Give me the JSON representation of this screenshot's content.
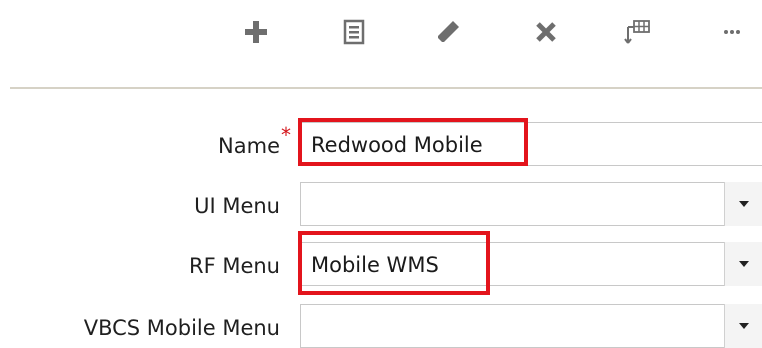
{
  "toolbar": {
    "actions": [
      {
        "icon": "add-icon"
      },
      {
        "icon": "details-icon"
      },
      {
        "icon": "edit-icon"
      },
      {
        "icon": "delete-icon"
      },
      {
        "icon": "grid-icon"
      },
      {
        "icon": "more-icon"
      }
    ],
    "icon_color": "#6e6e6e"
  },
  "form": {
    "name_label": "Name",
    "required_mark": "*",
    "name_value": "Redwood Mobile",
    "ui_menu_label": "UI Menu",
    "ui_menu_value": "",
    "rf_menu_label": "RF Menu",
    "rf_menu_value": "Mobile WMS",
    "vbcs_menu_label": "VBCS Mobile Menu",
    "vbcs_menu_value": ""
  },
  "colors": {
    "highlight": "#e3141c",
    "required": "#d4141a",
    "divider": "#d6d2c6"
  }
}
